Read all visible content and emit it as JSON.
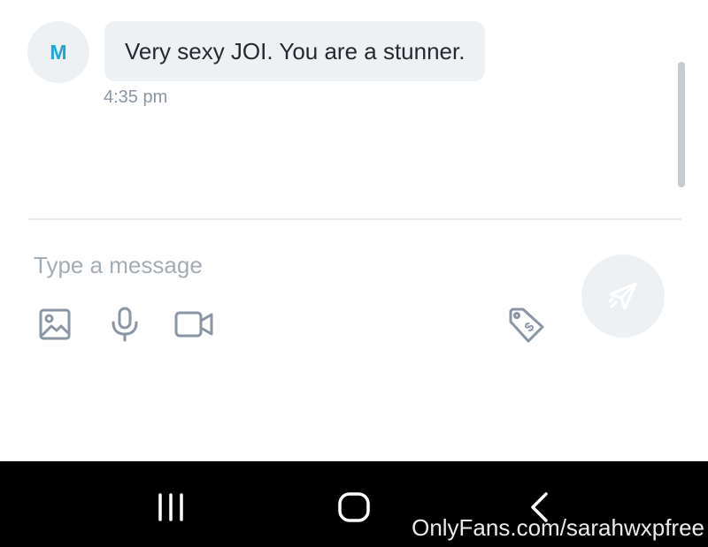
{
  "chat": {
    "sender_initial": "M",
    "message_text": "Very sexy JOI. You are a stunner.",
    "timestamp": "4:35 pm"
  },
  "composer": {
    "placeholder": "Type a message",
    "tools": [
      "image-icon",
      "microphone-icon",
      "video-camera-icon",
      "price-tag-icon"
    ],
    "send_icon": "send-icon"
  },
  "navbar": {
    "buttons": [
      "recent-apps-icon",
      "home-icon",
      "back-icon"
    ]
  },
  "watermark": "OnlyFans.com/sarahwxpfree",
  "colors": {
    "accent": "#1fa7d8",
    "bubble_bg": "#eef1f4",
    "muted_text": "#8a96a3",
    "icon_gray": "#8a96a3"
  }
}
